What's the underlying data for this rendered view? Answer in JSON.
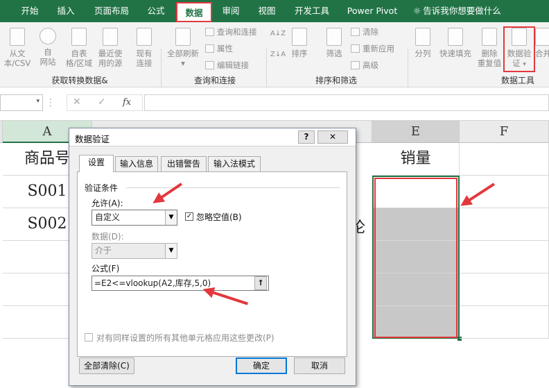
{
  "tabs": [
    "开始",
    "插入",
    "页面布局",
    "公式",
    "数据",
    "审阅",
    "视图",
    "开发工具",
    "Power Pivot"
  ],
  "tell_me": "告诉我你想要做什么",
  "ribbon": {
    "get_group": {
      "label": "获取转换数据&",
      "buttons": [
        "从文\n本/CSV",
        "自\n网站",
        "自表\n格/区域",
        "最近使\n用的源",
        "现有\n连接"
      ]
    },
    "query_group": {
      "label": "查询和连接",
      "refresh": "全部刷新",
      "items": [
        "查询和连接",
        "属性",
        "编辑链接"
      ]
    },
    "sort_group": {
      "label": "排序和筛选",
      "sort": "排序",
      "filter": "筛选",
      "items": [
        "清除",
        "重新应用",
        "高级"
      ]
    },
    "tools_group": {
      "label": "数据工具",
      "split": "分列",
      "flash_fill": "快速填充",
      "remove_dup": "删除\n重复值",
      "validation": "数据验\n证",
      "merge": "合并"
    }
  },
  "formula_bar": {
    "fx": "fx"
  },
  "columns": [
    "A",
    "E",
    "F"
  ],
  "cells": {
    "a1": "商品号",
    "a2": "S001",
    "a3": "S002",
    "e1": "销量",
    "partial_text": "论"
  },
  "dialog": {
    "title": "数据验证",
    "tabs": [
      "设置",
      "输入信息",
      "出错警告",
      "输入法模式"
    ],
    "section": "验证条件",
    "allow_label": "允许(A):",
    "allow_value": "自定义",
    "ignore_blank": "忽略空值(B)",
    "data_label": "数据(D):",
    "data_value": "介于",
    "formula_label": "公式(F)",
    "formula_value": "=E2<=vlookup(A2,库存,5,0)",
    "apply_all": "对有同样设置的所有其他单元格应用这些更改(P)",
    "clear_all": "全部清除(C)",
    "ok": "确定",
    "cancel": "取消"
  },
  "accent": "#217346",
  "highlight": "#e2383d"
}
